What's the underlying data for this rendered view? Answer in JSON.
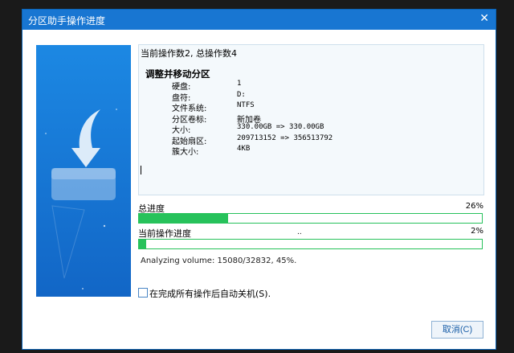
{
  "window": {
    "title": "分区助手操作进度",
    "close_glyph": "✕"
  },
  "info": {
    "op_count": "当前操作数2, 总操作数4",
    "operation_title": "调整并移动分区",
    "rows": [
      {
        "label": "硬盘:",
        "value": "1"
      },
      {
        "label": "盘符:",
        "value": "D:"
      },
      {
        "label": "文件系统:",
        "value": "NTFS"
      },
      {
        "label": "分区卷标:",
        "value": "新加卷"
      },
      {
        "label": "大小:",
        "value": "330.00GB => 330.00GB"
      },
      {
        "label": "起始扇区:",
        "value": "209713152 => 356513792"
      },
      {
        "label": "簇大小:",
        "value": "4KB"
      }
    ]
  },
  "progress": {
    "total_label": "总进度",
    "total_percent": "26%",
    "total_value": 0.26,
    "current_label": "当前操作进度",
    "current_dots": "..",
    "current_percent": "2%",
    "current_value": 0.02,
    "status_text": "Analyzing volume: 15080/32832, 45%."
  },
  "footer": {
    "shutdown_label": "在完成所有操作后自动关机(S).",
    "shutdown_checked": false,
    "cancel_label": "取消(C)"
  },
  "icons": {
    "panel_illustration": "drive-download-icon"
  },
  "colors": {
    "title_bar": "#1876d2",
    "progress": "#27c25b",
    "panel": "#1670d4"
  }
}
